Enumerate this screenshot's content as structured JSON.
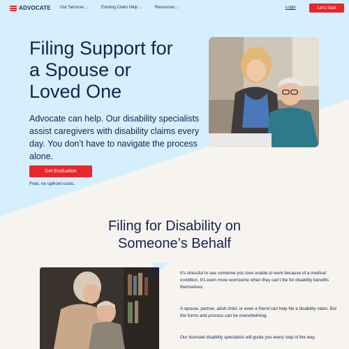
{
  "nav": {
    "logo": "ADVOCATE",
    "items": [
      {
        "label": "Our Services"
      },
      {
        "label": "Existing Claim Help"
      },
      {
        "label": "Resources"
      }
    ],
    "login": "Login",
    "cta": "Let's Start"
  },
  "hero": {
    "title_lines": [
      "Filing Support for",
      "a Spouse or",
      "Loved One"
    ],
    "body": "Advocate can help. Our disability specialists assist caregivers with disability claims every day. You don’t have to navigate the process alone.",
    "cta": "Get Evaluation",
    "note": "Free, no upfront costs."
  },
  "section": {
    "title_lines": [
      "Filing for Disability on",
      "Someone’s Behalf"
    ],
    "paragraphs": [
      "It’s stressful to see someone you love unable to work because of a medical condition. It’s even more worrisome when they can’t file for disability benefits themselves.",
      "A spouse, partner, adult child, or even a friend can help file a disability claim. But the forms and process can be overwhelming.",
      "Our licensed disability specialists will guide you every step of the way."
    ]
  },
  "colors": {
    "accent": "#e8262b",
    "navy": "#10234f",
    "hero_bg": "#d6efff",
    "page_bg": "#f7f4ef"
  }
}
